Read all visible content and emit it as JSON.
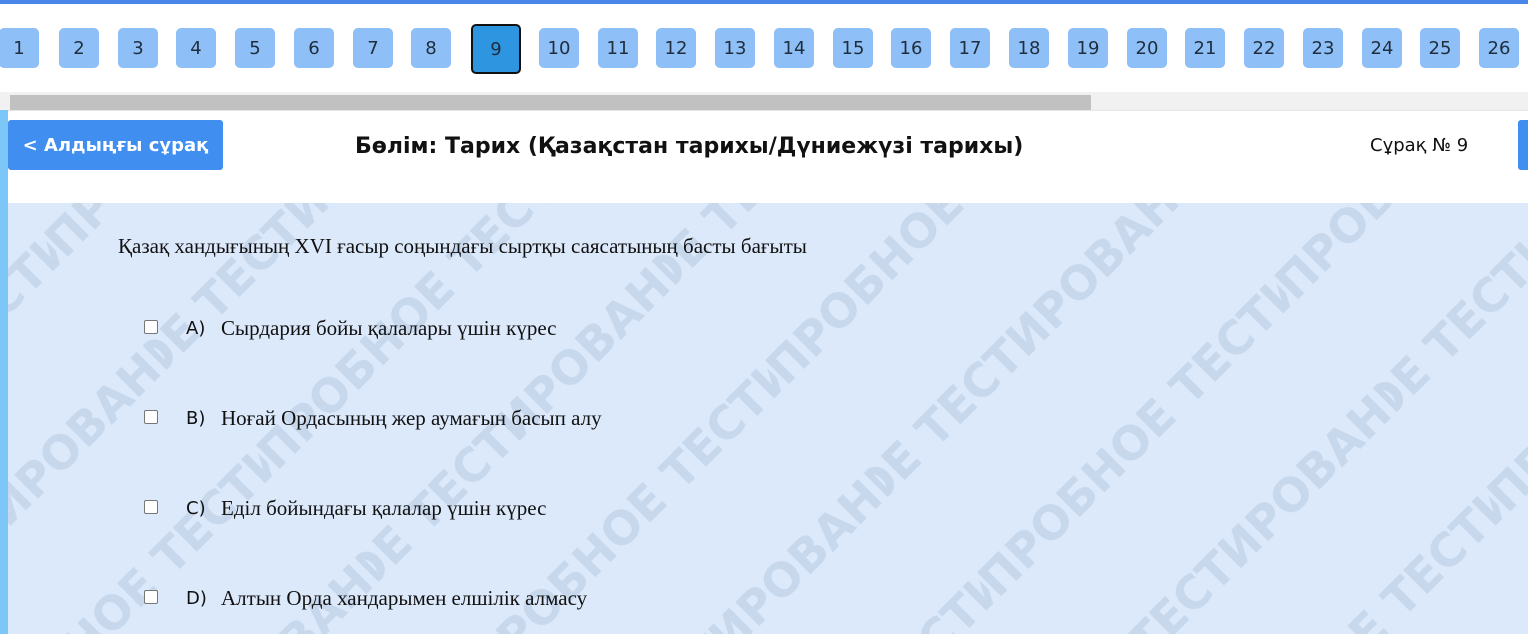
{
  "nav": {
    "numbers": [
      "1",
      "2",
      "3",
      "4",
      "5",
      "6",
      "7",
      "8",
      "9",
      "10",
      "11",
      "12",
      "13",
      "14",
      "15",
      "16",
      "17",
      "18",
      "19",
      "20",
      "21",
      "22",
      "23",
      "24",
      "25",
      "26"
    ],
    "active": "9"
  },
  "header": {
    "prev_label": "< Алдыңғы сұрақ",
    "section_title": "Бөлім: Тарих (Қазақстан тарихы/Дүниежүзі тарихы)",
    "question_number": "Сұрақ № 9"
  },
  "watermark": {
    "text": "ПРОБНОЕ ТЕСТИРОВАНИЕ"
  },
  "question": {
    "text": "Қазақ хандығының  XVI ғасыр соңындағы сыртқы саясатының басты бағыты",
    "answers": [
      {
        "letter": "A)",
        "text": "Сырдария бойы қалалары үшін күрес",
        "checked": false
      },
      {
        "letter": "B)",
        "text": "Ноғай Ордасының жер аумағын басып алу",
        "checked": false
      },
      {
        "letter": "C)",
        "text": "Еділ бойындағы қалалар үшін күрес",
        "checked": false
      },
      {
        "letter": "D)",
        "text": "Алтын Орда хандарымен елшілік алмасу",
        "checked": false
      }
    ]
  },
  "colors": {
    "accent": "#3f8ef0",
    "nav_button": "#8ebff7",
    "nav_active": "#2e95e0",
    "content_bg": "#dce9fb"
  }
}
